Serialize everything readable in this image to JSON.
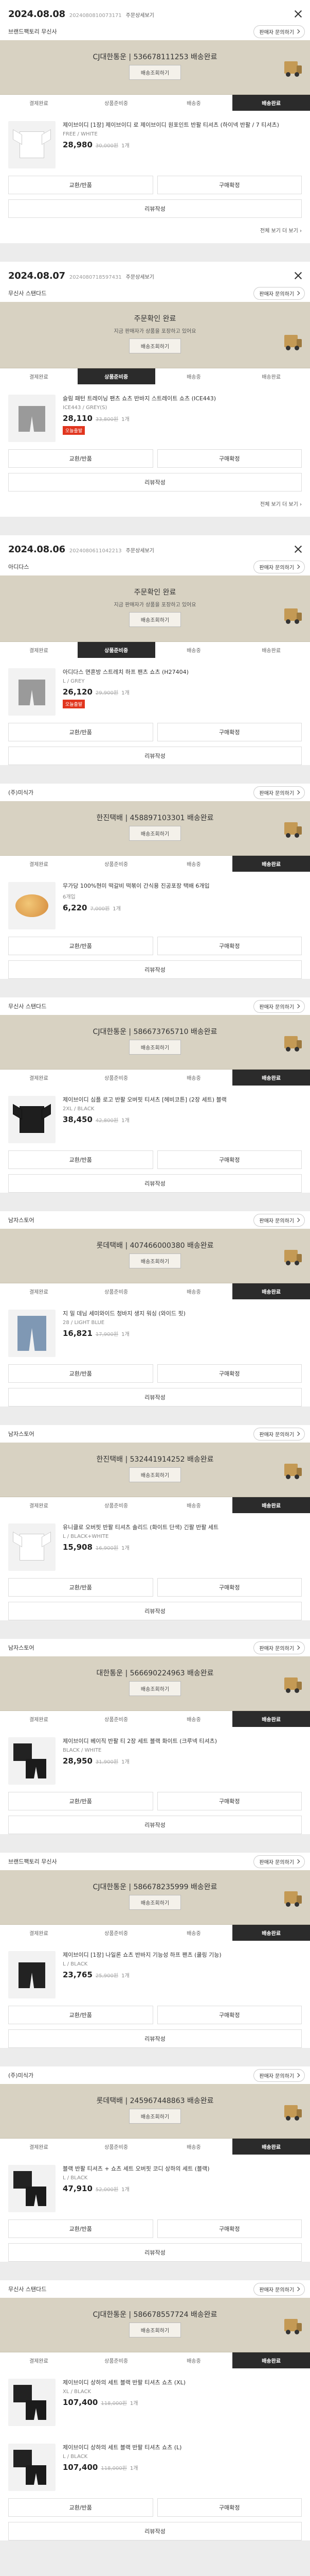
{
  "labels": {
    "detail": "주문상세보기",
    "inquiry": "판매자 문의하기",
    "track": "배송조회하기",
    "exchange_return": "교환/반품",
    "confirm": "구매확정",
    "review": "리뷰작성",
    "more": "전체 보기 더 보기",
    "steps": [
      "결제완료",
      "상품준비중",
      "배송중",
      "배송완료"
    ]
  },
  "orders": [
    {
      "date": "2024.08.08",
      "order_no": "2024080810073171",
      "seller": "브랜드팩토리 무신사",
      "status_title": "CJ대한통운 | 536678111253 배송완료",
      "status_sub": "",
      "active_step": 3,
      "items": [
        {
          "name": "제이브이디 [1장] 제이브이디 로 제이브이디 원포인트 반팔 티셔츠 (하이넥 반팔 / 7 티셔츠)",
          "option": "FREE / WHITE",
          "price": "28,980",
          "original": "30,000원",
          "qty": "1개",
          "badge": "",
          "art": "shirt"
        }
      ]
    },
    {
      "date": "2024.08.07",
      "order_no": "2024080718597431",
      "seller": "무신사 스탠다드",
      "status_title": "주문확인 완료",
      "status_sub": "지금 판매자가 상품을 포장하고 있어요",
      "active_step": 1,
      "items": [
        {
          "name": "슬림 패턴 트레이닝 팬츠 쇼츠 반바지 스트레이트 쇼츠 (ICE443)",
          "option": "ICE443 / GREY(S)",
          "price": "28,110",
          "original": "33,800원",
          "qty": "1개",
          "badge": "오늘출발",
          "art": "shorts"
        }
      ]
    },
    {
      "date": "2024.08.06",
      "order_no": "2024080611042213",
      "seller": "아디다스",
      "status_title": "주문확인 완료",
      "status_sub": "지금 판매자가 상품을 포장하고 있어요",
      "active_step": 1,
      "items": [
        {
          "name": "아디다스 면혼방 스트레치 하프 팬츠 쇼츠 (H27404)",
          "option": "L / GREY",
          "price": "26,120",
          "original": "29,900원",
          "qty": "1개",
          "badge": "오늘출발",
          "art": "shorts"
        }
      ]
    },
    {
      "date": "",
      "order_no": "",
      "seller": "(주)미식가",
      "status_title": "한진택배 | 458897103301 배송완료",
      "status_sub": "",
      "active_step": 3,
      "items": [
        {
          "name": "무가당 100%현미 떡갈비 떡볶이 간식용 진공포장 택배 6개입",
          "option": "6개입",
          "price": "6,220",
          "original": "7,000원",
          "qty": "1개",
          "badge": "",
          "art": "food"
        }
      ]
    },
    {
      "date": "",
      "order_no": "",
      "seller": "무신사 스탠다드",
      "status_title": "CJ대한통운 | 586673765710 배송완료",
      "status_sub": "",
      "active_step": 3,
      "items": [
        {
          "name": "제이브이디 심플 로고 반팔 오버핏 티셔츠 [헤비코튼] (2장 세트) 블랙",
          "option": "2XL / BLACK",
          "price": "38,450",
          "original": "42,800원",
          "qty": "1개",
          "badge": "",
          "art": "shirt-dark"
        }
      ]
    },
    {
      "date": "",
      "order_no": "",
      "seller": "남자스토어",
      "status_title": "롯데택배 | 407466000380 배송완료",
      "status_sub": "",
      "active_step": 3,
      "items": [
        {
          "name": "지 밀 데님 세미와이드 청바지 생지 워싱 (와이드 핏)",
          "option": "28 / LIGHT BLUE",
          "price": "16,821",
          "original": "17,900원",
          "qty": "1개",
          "badge": "",
          "art": "jeans"
        }
      ]
    },
    {
      "date": "",
      "order_no": "",
      "seller": "남자스토어",
      "status_title": "한진택배 | 532441914252 배송완료",
      "status_sub": "",
      "active_step": 3,
      "items": [
        {
          "name": "유니클로 오버핏 반팔 티셔츠 솔리드 (화이트 단색) 긴팔 반팔 세트",
          "option": "L / BLACK+WHITE",
          "price": "15,908",
          "original": "16,900원",
          "qty": "1개",
          "badge": "",
          "art": "shirt"
        }
      ]
    },
    {
      "date": "",
      "order_no": "",
      "seller": "남자스토어",
      "status_title": "대한통운 | 566690224963 배송완료",
      "status_sub": "",
      "active_step": 3,
      "items": [
        {
          "name": "제이브이디 베이직 반팔 티 2장 세트 블랙 화이트 (크루넥 티셔츠)",
          "option": "BLACK / WHITE",
          "price": "28,950",
          "original": "31,900원",
          "qty": "1개",
          "badge": "",
          "art": "set"
        }
      ]
    },
    {
      "date": "",
      "order_no": "",
      "seller": "브랜드팩토리 무신사",
      "status_title": "CJ대한통운 | 586678235999 배송완료",
      "status_sub": "",
      "active_step": 3,
      "items": [
        {
          "name": "제이브이디 [1장] 나일론 쇼츠 반바지 기능성 하프 팬츠 (쿨링 기능)",
          "option": "L / BLACK",
          "price": "23,765",
          "original": "25,900원",
          "qty": "1개",
          "badge": "",
          "art": "shorts-black"
        }
      ]
    },
    {
      "date": "",
      "order_no": "",
      "seller": "(주)미식가",
      "status_title": "롯데택배 | 245967448863 배송완료",
      "status_sub": "",
      "active_step": 3,
      "items": [
        {
          "name": "블랙 반팔 티셔츠 + 쇼츠 세트 오버핏 코디 상하의 세트 (블랙)",
          "option": "L / BLACK",
          "price": "47,910",
          "original": "52,000원",
          "qty": "1개",
          "badge": "",
          "art": "set"
        }
      ]
    },
    {
      "date": "",
      "order_no": "",
      "seller": "무신사 스탠다드",
      "status_title": "CJ대한통운 | 586678557724 배송완료",
      "status_sub": "",
      "active_step": 3,
      "items": [
        {
          "name": "제이브이디 상하의 세트 블랙 반팔 티셔츠 쇼츠 (XL)",
          "option": "XL / BLACK",
          "price": "107,400",
          "original": "118,000원",
          "qty": "1개",
          "badge": "",
          "art": "set"
        },
        {
          "name": "제이브이디 상하의 세트 블랙 반팔 티셔츠 쇼츠 (L)",
          "option": "L / BLACK",
          "price": "107,400",
          "original": "118,000원",
          "qty": "1개",
          "badge": "",
          "art": "set"
        }
      ]
    }
  ]
}
